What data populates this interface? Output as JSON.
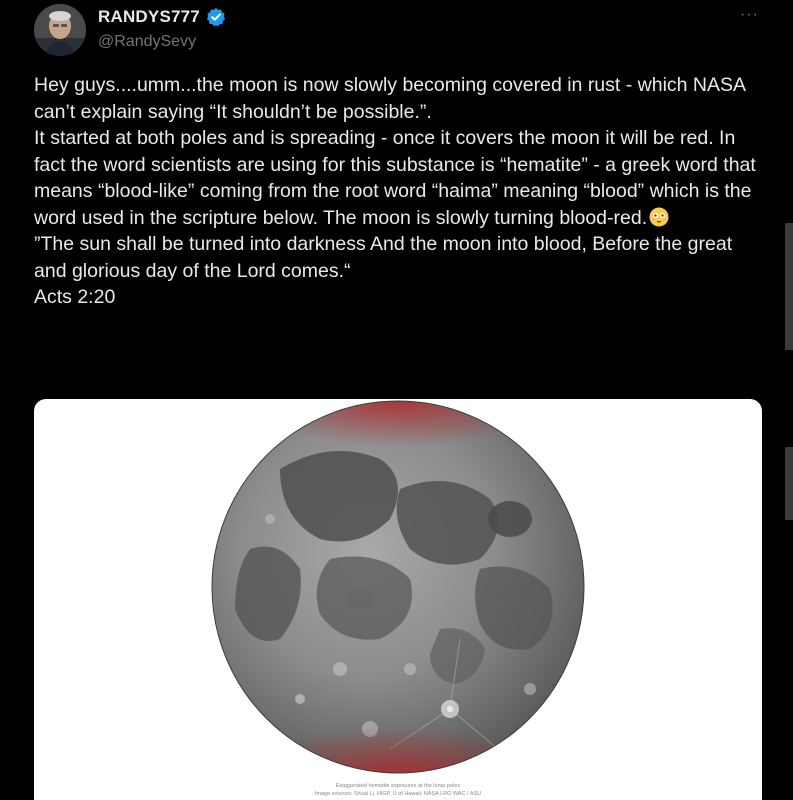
{
  "post": {
    "author": {
      "display_name": "RANDYS777",
      "handle": "@RandySevy",
      "verified": true,
      "avatar_icon": "avatar-photo"
    },
    "more_label": "···",
    "text_lines": [
      "Hey guys....umm...the moon is now slowly becoming covered in rust - which NASA can’t explain saying “It shouldn’t be possible.”.",
      "It started at both poles and is spreading - once it covers the moon it will be red. In fact the word scientists are using for this substance is “hematite” - a greek word that means “blood-like” coming from the root word “haima” meaning “blood” which is the word used in the scripture below. The moon is slowly turning blood-red.",
      "”The sun shall be turned into darkness And the moon into blood, Before the great and glorious day of the Lord comes.“",
      "Acts 2:20"
    ],
    "emoji_icon": "flushed-face-emoji",
    "media": {
      "caption_line1": "Exaggerated hematite exposures at the lunar poles",
      "caption_line2": "Image sources: Shuai Li, HIGP, U of Hawaii; NASA LRO WAC / ASU"
    }
  },
  "colors": {
    "background": "#000000",
    "text": "#e7e9ea",
    "muted": "#71767b",
    "verified_blue": "#1d9bf0",
    "hematite_red": "#b3262a"
  }
}
